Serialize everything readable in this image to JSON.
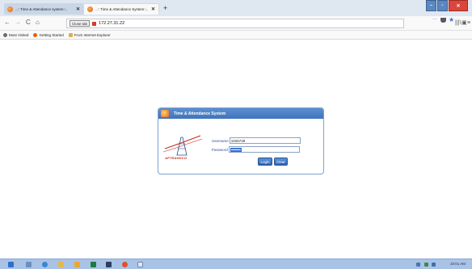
{
  "browser": {
    "tabs": [
      {
        "label": "..:: Time & Attendance system::..",
        "active": false
      },
      {
        "label": "..:: Time & Attendance System::..",
        "active": true
      }
    ],
    "new_tab_symbol": "+",
    "tab_close_symbol": "✕",
    "window_controls": {
      "minimize": "–",
      "maximize": "▫",
      "close": "✕"
    },
    "nav": {
      "back": "←",
      "forward": "→",
      "reload": "C",
      "home": "⌂"
    },
    "address": {
      "close_tab_button": "Close tab",
      "url": "172.27.31.22"
    },
    "address_icons": {
      "menu_dots": "···",
      "pocket": "pocket-icon",
      "star": "★"
    },
    "toolbar_right": {
      "library": "|||\\",
      "sidebar": "▣",
      "menu": "≡"
    },
    "bookmarks": [
      {
        "label": "Most Visited",
        "icon": "gear-icon"
      },
      {
        "label": "Getting Started",
        "icon": "firefox-icon"
      },
      {
        "label": "From Internet Explorer",
        "icon": "folder-icon"
      }
    ]
  },
  "login": {
    "title": "Time & Attendance System",
    "brand_name": "APTRANSCO",
    "username_label": "Username",
    "username_value": "1025749",
    "password_label": "Password",
    "password_value": "••••••••••",
    "login_button": "Login",
    "clear_button": "Clear"
  },
  "taskbar": {
    "icons": [
      "start-icon",
      "people-icon",
      "ie-icon",
      "folder-icon",
      "media-icon",
      "excel-icon",
      "terminal-icon",
      "firefox-icon",
      "notepad-icon"
    ],
    "tray_time": "10:01 AM"
  },
  "colors": {
    "panel_header": "#4a7fc4",
    "button": "#3b73c2",
    "taskbar": "#a9c3e6",
    "brand_red": "#c1281e"
  }
}
